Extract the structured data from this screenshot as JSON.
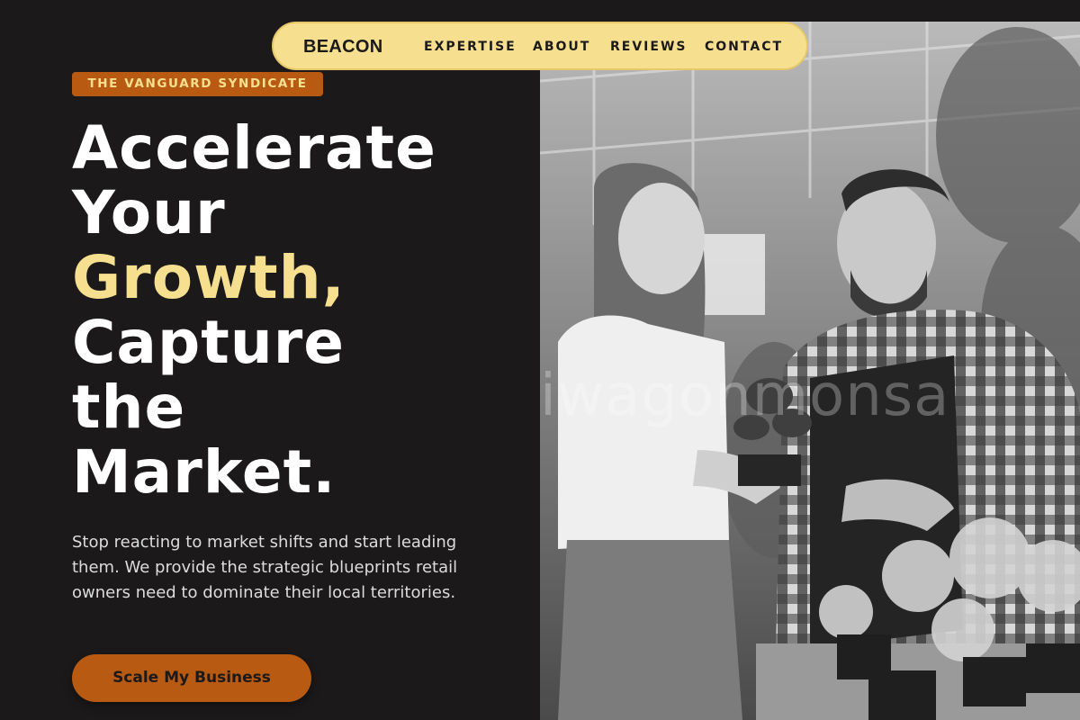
{
  "nav": {
    "brand": "BEACON",
    "links": [
      "EXPERTISE",
      "ABOUT",
      "REVIEWS",
      "CONTACT"
    ]
  },
  "hero": {
    "eyebrow": "THE VANGUARD SYNDICATE",
    "headline_lines": [
      "Accelerate",
      "Your",
      "Growth,",
      "Capture",
      "the",
      "Market."
    ],
    "highlighted_word": "Growth,",
    "description": "Stop reacting to market shifts and start leading them. We provide the strategic blueprints retail owners need to dominate their local territories.",
    "cta_label": "Scale My Business"
  },
  "photo": {
    "watermark": "iwagonmonsa",
    "subject": "greenhouse-staff-photo"
  },
  "colors": {
    "background": "#1b1919",
    "accent_yellow": "#f6e08f",
    "accent_orange": "#b95a12",
    "text_light": "#ffffff"
  }
}
